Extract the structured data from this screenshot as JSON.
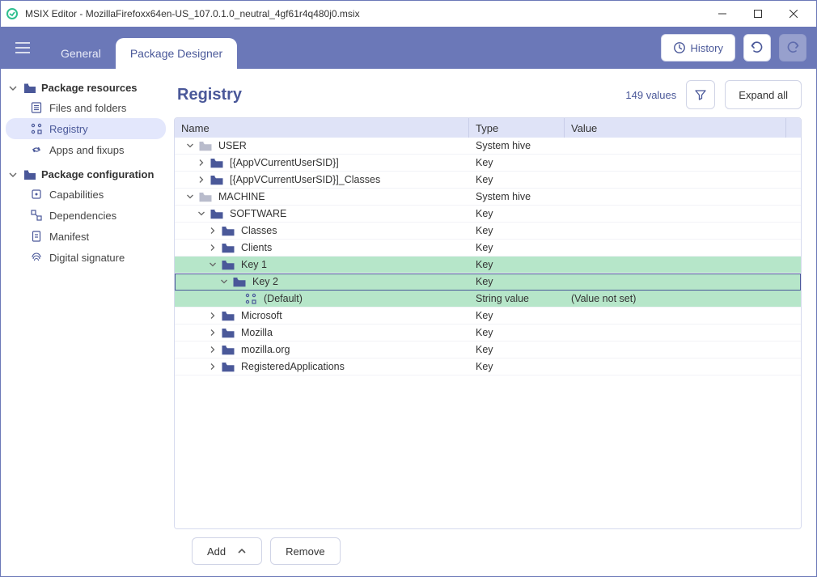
{
  "titlebar": {
    "app_name": "MSIX Editor",
    "file": "MozillaFirefoxx64en-US_107.0.1.0_neutral_4gf61r4q480j0.msix"
  },
  "topbar": {
    "tabs": {
      "general": "General",
      "designer": "Package Designer"
    },
    "history": "History"
  },
  "sidebar": {
    "resources": {
      "label": "Package resources",
      "items": {
        "files": "Files and folders",
        "registry": "Registry",
        "apps": "Apps and fixups"
      }
    },
    "config": {
      "label": "Package configuration",
      "items": {
        "caps": "Capabilities",
        "deps": "Dependencies",
        "manifest": "Manifest",
        "sig": "Digital signature"
      }
    }
  },
  "main": {
    "title": "Registry",
    "count": "149 values",
    "expand": "Expand all",
    "columns": {
      "name": "Name",
      "type": "Type",
      "value": "Value"
    },
    "rows": [
      {
        "indent": 0,
        "chev": "down",
        "icon": "folder-grey",
        "name": "USER",
        "type": "System hive",
        "value": "",
        "state": ""
      },
      {
        "indent": 1,
        "chev": "right",
        "icon": "folder",
        "name": "[{AppVCurrentUserSID}]",
        "type": "Key",
        "value": "",
        "state": ""
      },
      {
        "indent": 1,
        "chev": "right",
        "icon": "folder",
        "name": "[{AppVCurrentUserSID}]_Classes",
        "type": "Key",
        "value": "",
        "state": ""
      },
      {
        "indent": 0,
        "chev": "down",
        "icon": "folder-grey",
        "name": "MACHINE",
        "type": "System hive",
        "value": "",
        "state": ""
      },
      {
        "indent": 1,
        "chev": "down",
        "icon": "folder",
        "name": "SOFTWARE",
        "type": "Key",
        "value": "",
        "state": ""
      },
      {
        "indent": 2,
        "chev": "right",
        "icon": "folder",
        "name": "Classes",
        "type": "Key",
        "value": "",
        "state": ""
      },
      {
        "indent": 2,
        "chev": "right",
        "icon": "folder",
        "name": "Clients",
        "type": "Key",
        "value": "",
        "state": ""
      },
      {
        "indent": 2,
        "chev": "down",
        "icon": "folder",
        "name": "Key 1",
        "type": "Key",
        "value": "",
        "state": "sel"
      },
      {
        "indent": 3,
        "chev": "down",
        "icon": "folder",
        "name": "Key 2",
        "type": "Key",
        "value": "",
        "state": "selected"
      },
      {
        "indent": 4,
        "chev": "",
        "icon": "reg",
        "name": "(Default)",
        "type": "String value",
        "value": "(Value not set)",
        "state": "sel"
      },
      {
        "indent": 2,
        "chev": "right",
        "icon": "folder",
        "name": "Microsoft",
        "type": "Key",
        "value": "",
        "state": ""
      },
      {
        "indent": 2,
        "chev": "right",
        "icon": "folder",
        "name": "Mozilla",
        "type": "Key",
        "value": "",
        "state": ""
      },
      {
        "indent": 2,
        "chev": "right",
        "icon": "folder",
        "name": "mozilla.org",
        "type": "Key",
        "value": "",
        "state": ""
      },
      {
        "indent": 2,
        "chev": "right",
        "icon": "folder",
        "name": "RegisteredApplications",
        "type": "Key",
        "value": "",
        "state": ""
      }
    ]
  },
  "footer": {
    "add": "Add",
    "remove": "Remove"
  }
}
